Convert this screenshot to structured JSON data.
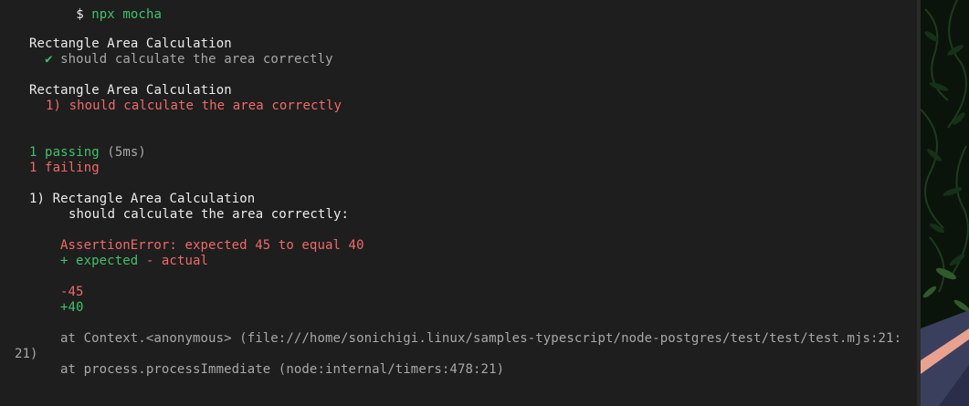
{
  "terminal": {
    "prompt_symbol": "$",
    "command": "npx mocha",
    "suite1": {
      "title": "Rectangle Area Calculation",
      "check": "✔",
      "test": "should calculate the area correctly"
    },
    "suite2": {
      "title": "Rectangle Area Calculation",
      "test": "1) should calculate the area correctly"
    },
    "summary": {
      "passing": "1 passing",
      "duration": "(5ms)",
      "failing": "1 failing"
    },
    "failure": {
      "heading": "1) Rectangle Area Calculation",
      "test": "should calculate the area correctly:",
      "error": "AssertionError: expected 45 to equal 40",
      "legend_expected": "+ expected",
      "legend_actual": "- actual",
      "minus_line": "-45",
      "plus_line": "+40",
      "stack1": "at Context.<anonymous> (file:///home/sonichigi.linux/samples-typescript/node-postgres/test/test/test.mjs:21:",
      "stack1_wrap": "21)",
      "stack2": "at process.processImmediate (node:internal/timers:478:21)"
    }
  },
  "colors": {
    "background": "#1e1e1e",
    "pass_green": "#3ec26a",
    "fail_red": "#ef6a6a"
  }
}
